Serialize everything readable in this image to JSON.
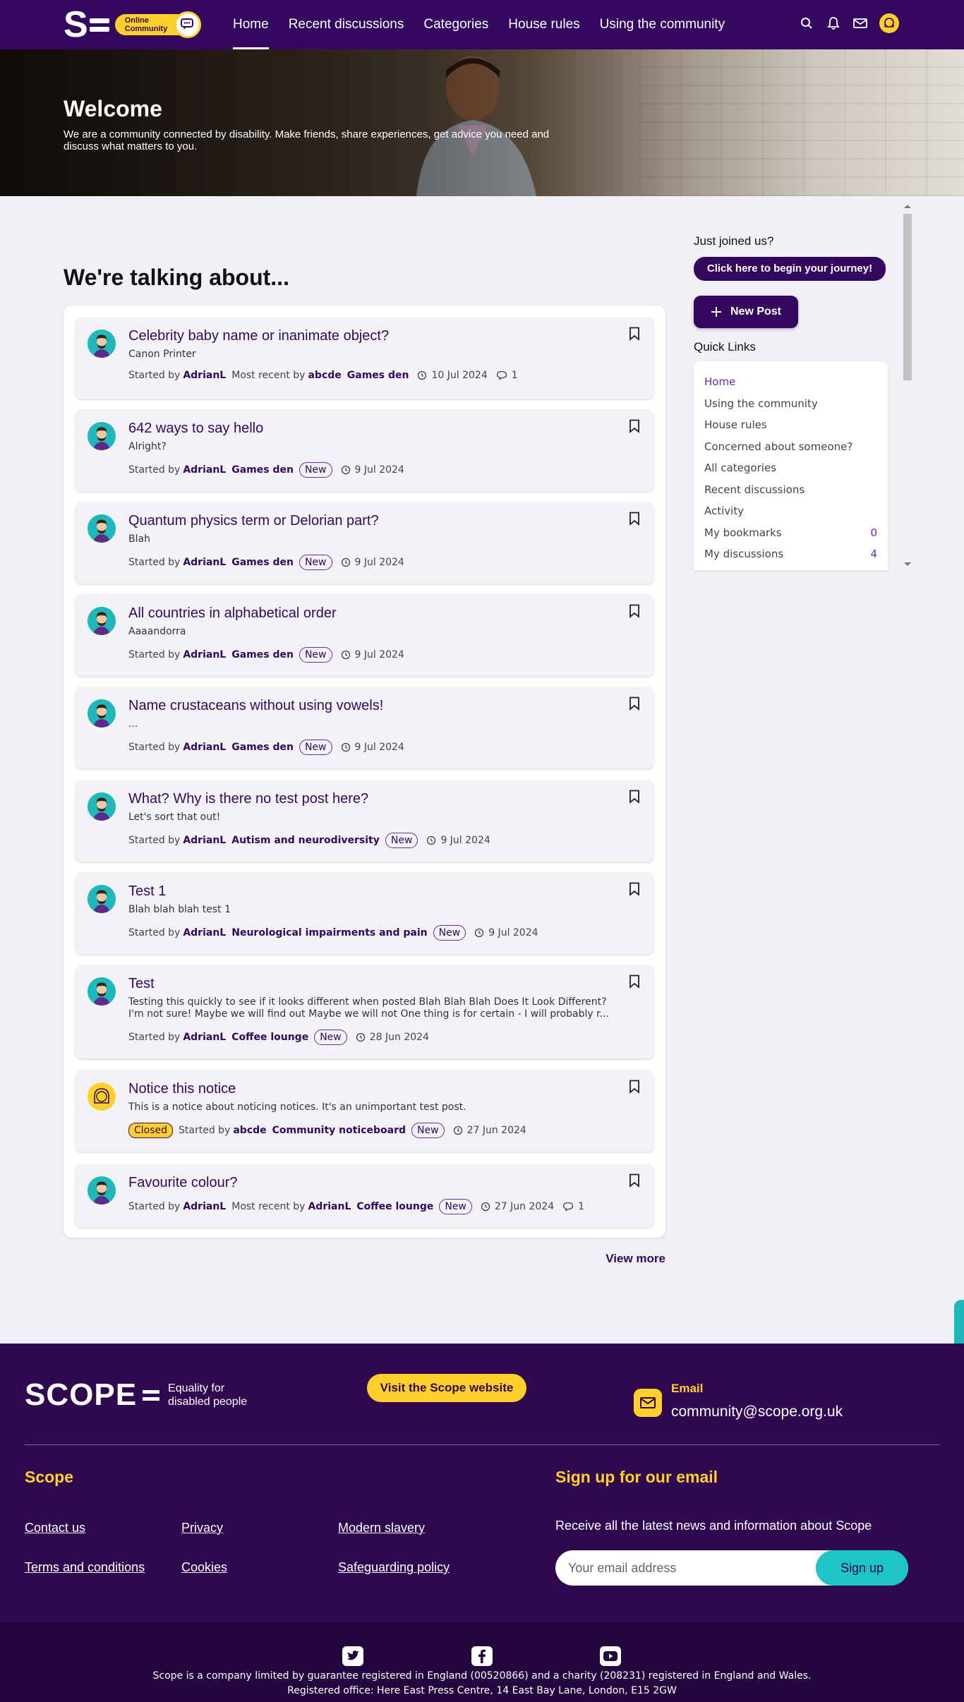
{
  "header": {
    "logo_line1": "Online",
    "logo_line2": "Community",
    "nav": [
      "Home",
      "Recent discussions",
      "Categories",
      "House rules",
      "Using the community"
    ],
    "icons": [
      "search-icon",
      "bell-icon",
      "mail-icon",
      "user-avatar"
    ]
  },
  "hero": {
    "title": "Welcome",
    "text": "We are a community connected by disability. Make friends, share experiences, get advice you need and discuss what matters to you."
  },
  "main": {
    "title": "We're talking about...",
    "view_more": "View more",
    "started_by": "Started by",
    "most_recent_by": "Most recent by",
    "new_label": "New",
    "closed_label": "Closed",
    "discussions": [
      {
        "title": "Celebrity baby name or inanimate object?",
        "excerpt": "Canon Printer",
        "author": "AdrianL",
        "recent_by": "abcde",
        "category": "Games den",
        "date": "10 Jul 2024",
        "comments": "1"
      },
      {
        "title": "642 ways to say hello",
        "excerpt": "Alright?",
        "author": "AdrianL",
        "category": "Games den",
        "date": "9 Jul 2024"
      },
      {
        "title": "Quantum physics term or Delorian part?",
        "excerpt": "Blah",
        "author": "AdrianL",
        "category": "Games den",
        "date": "9 Jul 2024"
      },
      {
        "title": "All countries in alphabetical order",
        "excerpt": "Aaaandorra",
        "author": "AdrianL",
        "category": "Games den",
        "date": "9 Jul 2024"
      },
      {
        "title": "Name crustaceans without using vowels!",
        "excerpt": "...",
        "author": "AdrianL",
        "category": "Games den",
        "date": "9 Jul 2024"
      },
      {
        "title": "What? Why is there no test post here?",
        "excerpt": "Let's sort that out!",
        "author": "AdrianL",
        "category": "Autism and neurodiversity",
        "date": "9 Jul 2024"
      },
      {
        "title": "Test 1",
        "excerpt": "Blah blah blah test 1",
        "author": "AdrianL",
        "category": "Neurological impairments and pain",
        "date": "9 Jul 2024"
      },
      {
        "title": "Test",
        "excerpt": "Testing this quickly to see if it looks different when posted Blah Blah Blah Does It Look Different? I'm not sure! Maybe we will find out Maybe we will not One thing is for certain - I will probably r...",
        "author": "AdrianL",
        "category": "Coffee lounge",
        "date": "28 Jun 2024"
      },
      {
        "title": "Notice this notice",
        "excerpt": "This is a notice about noticing notices. It's an unimportant test post.",
        "author": "abcde",
        "category": "Community noticeboard",
        "date": "27 Jun 2024"
      },
      {
        "title": "Favourite colour?",
        "author": "AdrianL",
        "recent_by": "AdrianL",
        "category": "Coffee lounge",
        "date": "27 Jun 2024",
        "comments": "1"
      }
    ]
  },
  "sidebar": {
    "joined_title": "Just joined us?",
    "journey_button": "Click here to begin your journey!",
    "new_post_button": "New Post",
    "quick_links_title": "Quick Links",
    "quick_links": [
      {
        "label": "Home"
      },
      {
        "label": "Using the community"
      },
      {
        "label": "House rules"
      },
      {
        "label": "Concerned about someone?"
      },
      {
        "label": "All categories"
      },
      {
        "label": "Recent discussions"
      },
      {
        "label": "Activity"
      },
      {
        "label": "My bookmarks",
        "count": "0"
      },
      {
        "label": "My discussions",
        "count": "4"
      }
    ]
  },
  "footer": {
    "logo_word": "SCOPE",
    "tagline_line1": "Equality for",
    "tagline_line2": "disabled people",
    "visit_button": "Visit the Scope website",
    "email_label": "Email",
    "email_value": "community@scope.org.uk",
    "scope_heading": "Scope",
    "links": [
      "Contact us",
      "Privacy",
      "Modern slavery",
      "Terms and conditions",
      "Cookies",
      "Safeguarding policy"
    ],
    "signup_heading": "Sign up for our email",
    "signup_text": "Receive all the latest news and information about Scope",
    "email_placeholder": "Your email address",
    "signup_button": "Sign up",
    "social": [
      "twitter-icon",
      "facebook-icon",
      "youtube-icon"
    ],
    "legal_line1": "Scope is a company limited by guarantee registered in England (00520866) and a charity (208231) registered in England and Wales.",
    "legal_line2": "Registered office: Here East Press Centre, 14 East Bay Lane, London, E15 2GW"
  },
  "colors": {
    "brand_purple": "#33085e",
    "accent_yellow": "#ffd02b",
    "accent_teal": "#1fc4c6"
  }
}
